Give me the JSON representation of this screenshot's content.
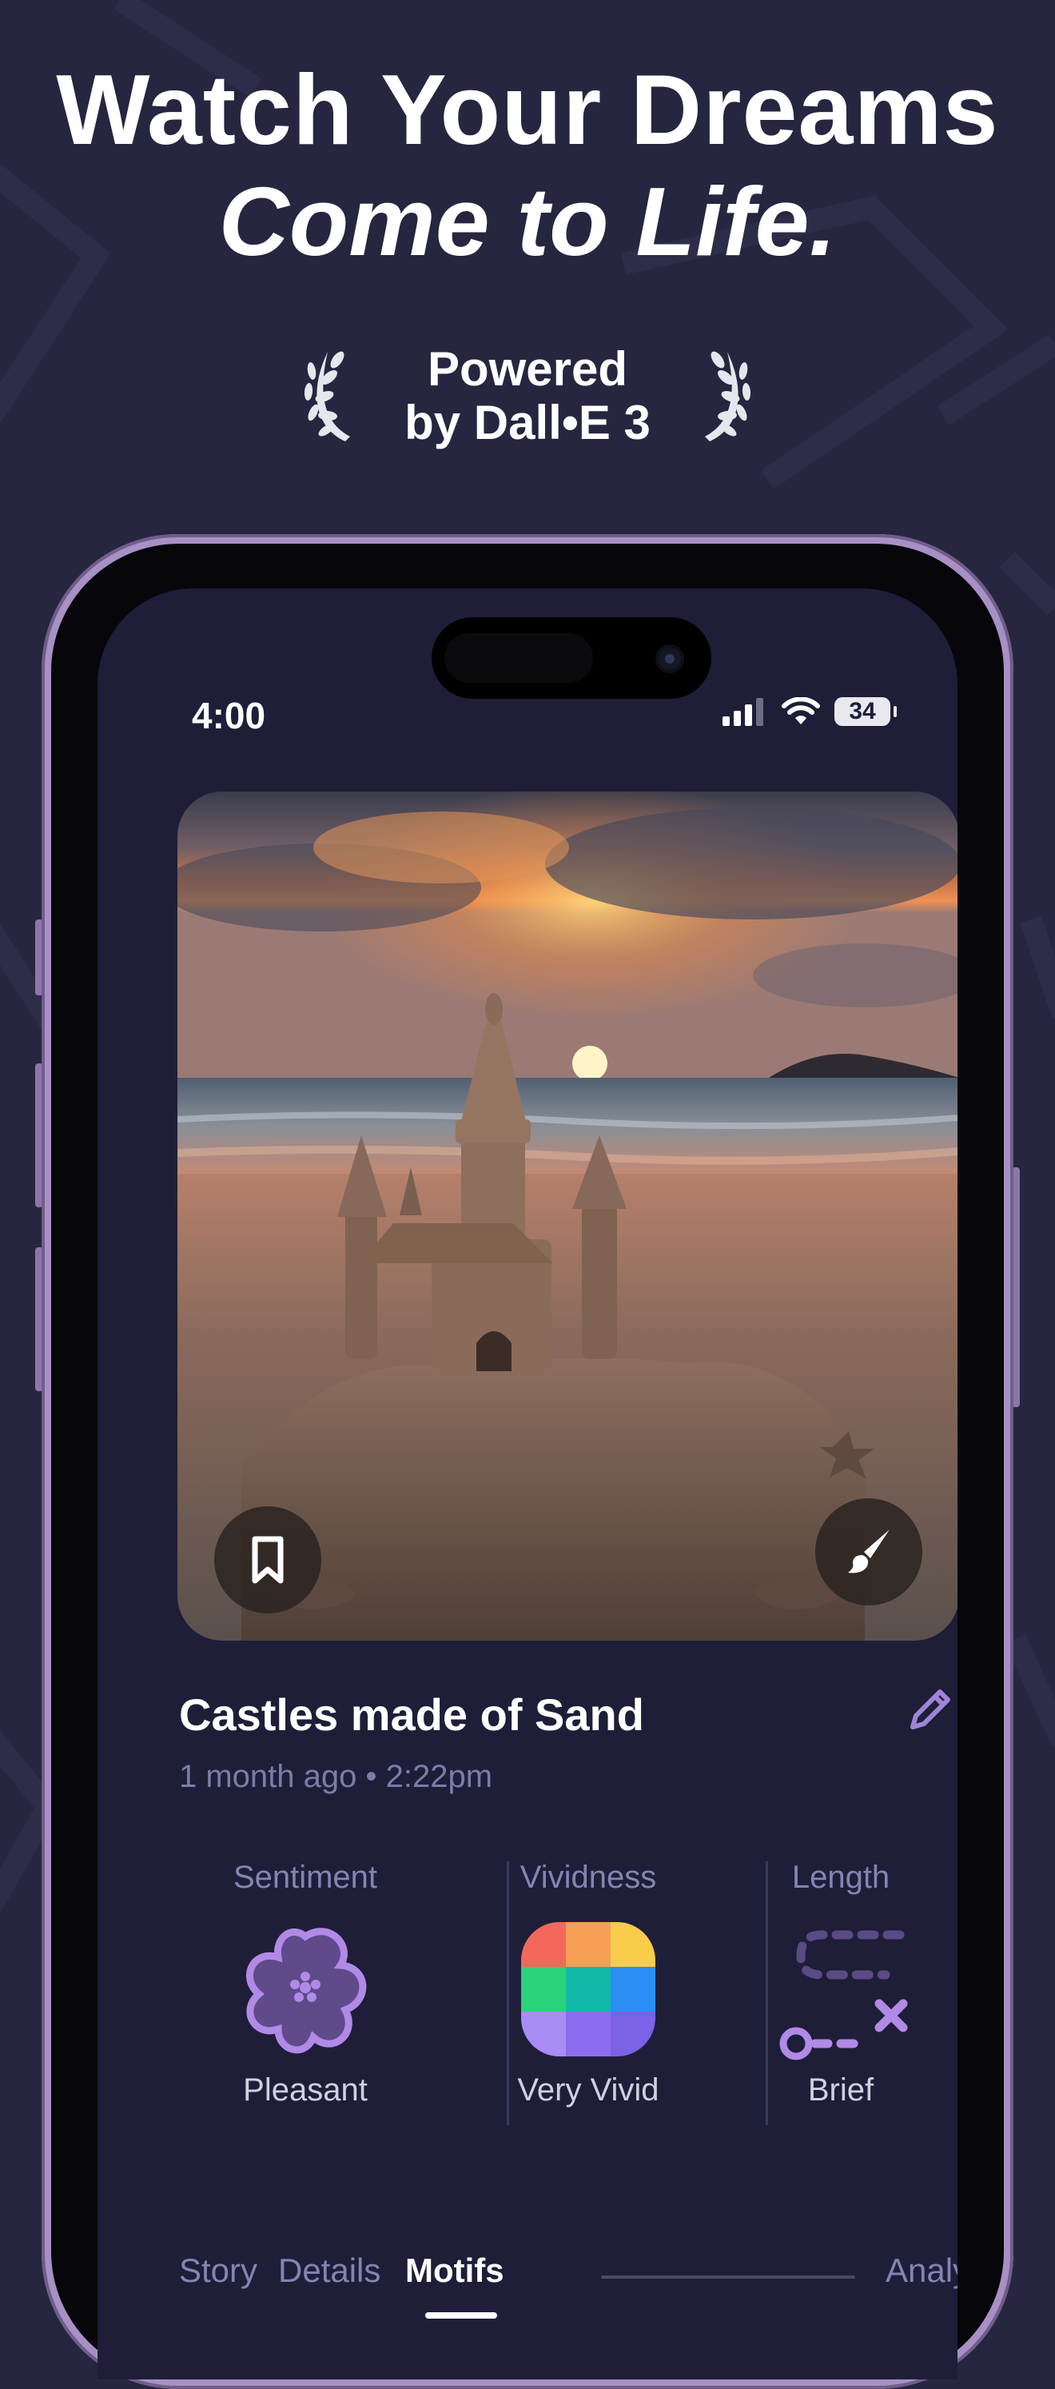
{
  "headline": {
    "line1": "Watch Your Dreams",
    "line2": "Come to Life."
  },
  "badge": {
    "line1": "Powered",
    "line2": "by Dall•E 3"
  },
  "status_bar": {
    "time": "4:00",
    "battery": "34"
  },
  "dream": {
    "title": "Castles made of Sand",
    "date": "1 month ago • 2:22pm",
    "image_icon_name": "sandcastle-sunset-image"
  },
  "metrics": [
    {
      "label": "Sentiment",
      "value": "Pleasant",
      "icon": "flower-icon"
    },
    {
      "label": "Vividness",
      "value": "Very Vivid",
      "icon": "color-grid-icon"
    },
    {
      "label": "Length",
      "value": "Brief",
      "icon": "path-icon"
    }
  ],
  "tabs": [
    {
      "label": "Story",
      "active": false
    },
    {
      "label": "Details",
      "active": false
    },
    {
      "label": "Motifs",
      "active": true
    },
    {
      "label": "Analysis",
      "active": false
    }
  ],
  "colors": {
    "background": "#262640",
    "screen": "#1f1e38",
    "accent": "#b08ae6",
    "muted_text": "#7c7ca8"
  }
}
